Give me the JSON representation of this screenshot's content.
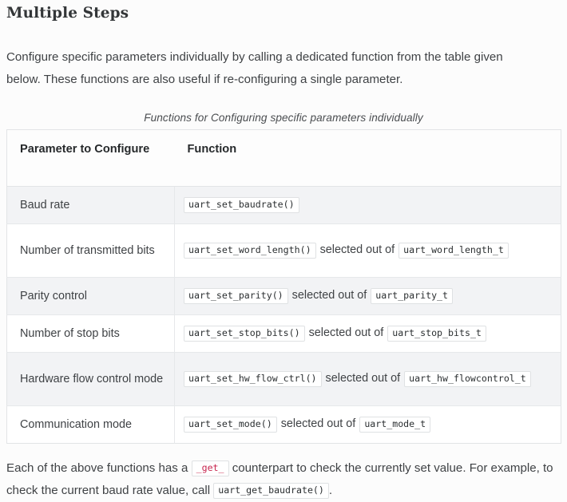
{
  "section": {
    "title": "Multiple Steps",
    "intro_paragraph": "Configure specific parameters individually by calling a dedicated function from the table given below. These functions are also useful if re-configuring a single parameter."
  },
  "table": {
    "caption": "Functions for Configuring specific parameters individually",
    "headers": [
      "Parameter to Configure",
      "Function"
    ],
    "connector_label": "selected out of",
    "rows": [
      {
        "parameter": "Baud rate",
        "function": "uart_set_baudrate()",
        "connector": "",
        "enum_type": ""
      },
      {
        "parameter": "Number of transmitted bits",
        "function": "uart_set_word_length()",
        "connector": "selected out of",
        "enum_type": "uart_word_length_t"
      },
      {
        "parameter": "Parity control",
        "function": "uart_set_parity()",
        "connector": "selected out of",
        "enum_type": "uart_parity_t"
      },
      {
        "parameter": "Number of stop bits",
        "function": "uart_set_stop_bits()",
        "connector": "selected out of",
        "enum_type": "uart_stop_bits_t"
      },
      {
        "parameter": "Hardware flow control mode",
        "function": "uart_set_hw_flow_ctrl()",
        "connector": "selected out of",
        "enum_type": "uart_hw_flowcontrol_t"
      },
      {
        "parameter": "Communication mode",
        "function": "uart_set_mode()",
        "connector": "selected out of",
        "enum_type": "uart_mode_t"
      }
    ]
  },
  "footer_note": {
    "part1": "Each of the above functions has a",
    "code1": "_get_",
    "part2": "counterpart to check the currently set value. For example, to check the current baud rate value, call",
    "code2": "uart_get_baudrate()",
    "part3": "."
  },
  "colors": {
    "page_background": "#fcfcfc",
    "text": "#3f4245",
    "heading": "#333638",
    "table_border": "#e2e4e6",
    "row_stripe": "#f2f3f5",
    "code_chip_border": "#dfe1e3",
    "code_red": "#c7254e"
  }
}
